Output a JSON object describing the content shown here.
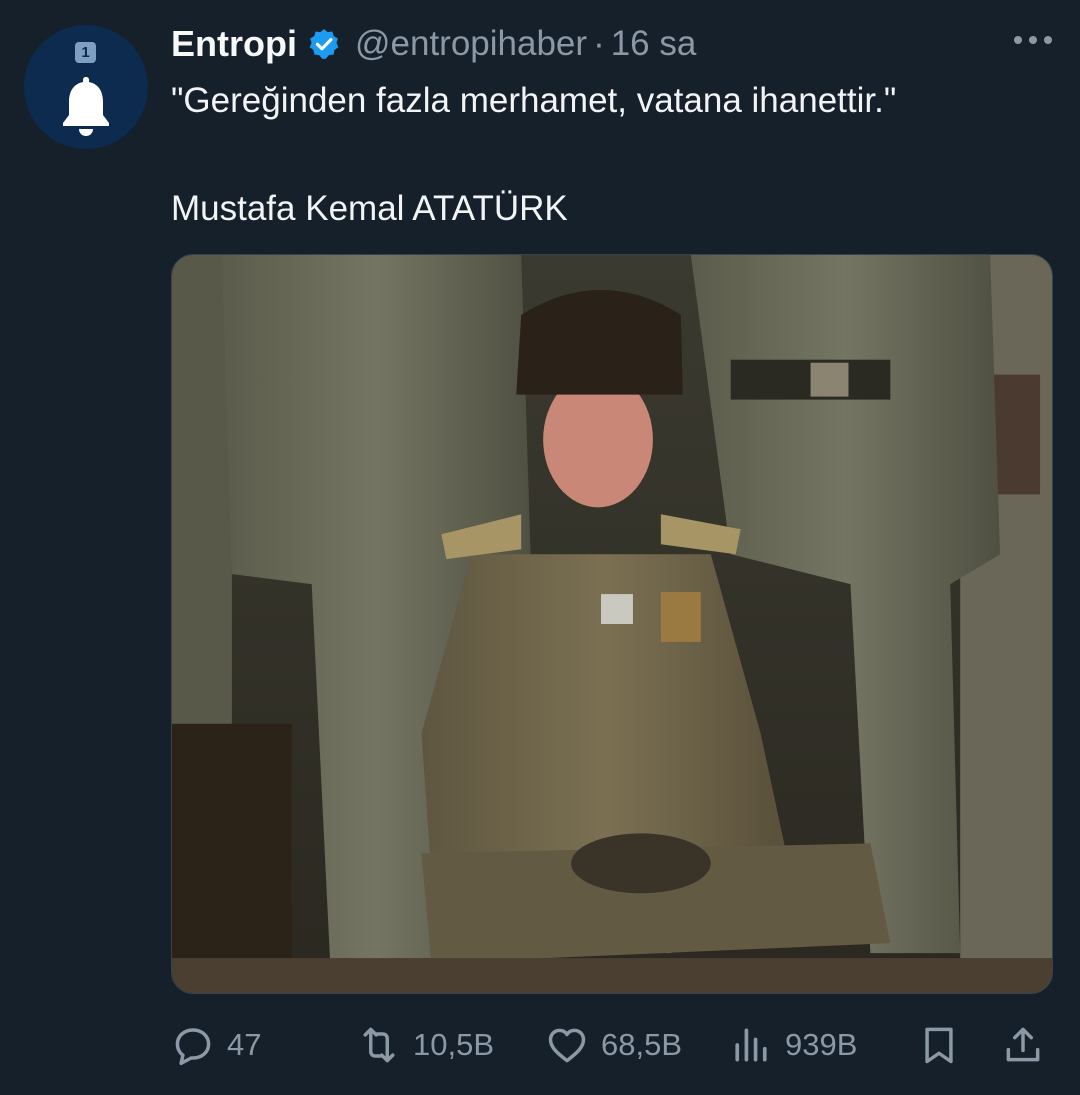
{
  "tweet": {
    "author_name": "Entropi",
    "verified": true,
    "handle": "@entropihaber",
    "separator": "·",
    "time": "16 sa",
    "text_line1": "\"Gereğinden fazla merhamet, vatana ihanettir.\"",
    "text_line2": "Mustafa Kemal ATATÜRK"
  },
  "avatar": {
    "badge": "1",
    "icon": "bell-icon"
  },
  "actions": {
    "replies": "47",
    "retweets": "10,5B",
    "likes": "68,5B",
    "views": "939B"
  },
  "colors": {
    "background": "#15202b",
    "secondary_text": "#8b98a5",
    "verified_blue": "#1d9bf0",
    "avatar_bg": "#0c2b4f"
  }
}
